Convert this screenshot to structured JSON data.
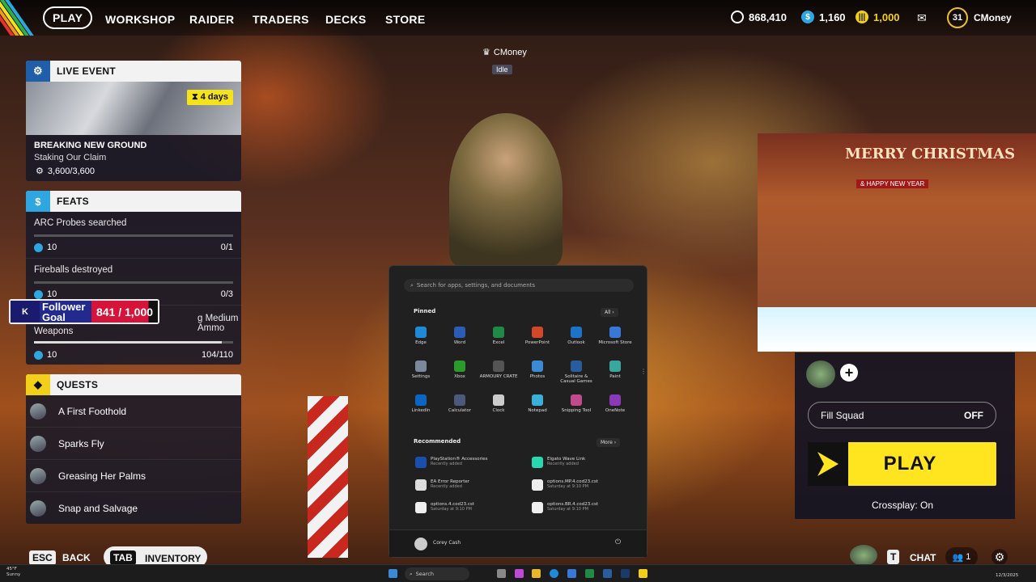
{
  "nav": {
    "play": "PLAY",
    "workshop": "WORKSHOP",
    "raider": "RAIDER",
    "traders": "TRADERS",
    "decks": "DECKS",
    "store": "STORE"
  },
  "currency": {
    "coins": "868,410",
    "tokens": "1,160",
    "credits": "1,000"
  },
  "profile": {
    "level": "31",
    "username": "CMoney"
  },
  "live_event": {
    "header": "LIVE EVENT",
    "days": "4 days",
    "title": "BREAKING NEW GROUND",
    "subtitle": "Staking Our Claim",
    "progress": "3,600/3,600"
  },
  "feats": {
    "header": "FEATS",
    "items": [
      {
        "name": "ARC Probes searched",
        "reward": "10",
        "count": "0/1",
        "progress": 0
      },
      {
        "name": "Fireballs destroyed",
        "reward": "10",
        "count": "0/3",
        "progress": 0
      },
      {
        "name_tail": "g Medium Ammo",
        "name": "Weapons",
        "reward": "10",
        "count": "104/110",
        "progress": 0.945
      }
    ]
  },
  "follower_goal": {
    "label": "Follower Goal",
    "value": "841 / 1,000",
    "fraction": 0.841
  },
  "quests": {
    "header": "QUESTS",
    "items": [
      "A First Foothold",
      "Sparks Fly",
      "Greasing Her Palms",
      "Snap and Salvage"
    ]
  },
  "bottom_left": {
    "esc_key": "ESC",
    "back": "BACK",
    "tab_key": "TAB",
    "inventory": "INVENTORY"
  },
  "center": {
    "name": "CMoney",
    "status": "Idle"
  },
  "overlay": {
    "title": "MERRY CHRISTMAS",
    "subtitle": "& HAPPY NEW YEAR"
  },
  "squad": {
    "fill_label": "Fill Squad",
    "fill_value": "OFF",
    "play": "PLAY",
    "crossplay": "Crossplay: On"
  },
  "bottom_right": {
    "t_key": "T",
    "chat": "CHAT",
    "friends": "1"
  },
  "start_menu": {
    "search_placeholder": "Search for apps, settings, and documents",
    "pinned_label": "Pinned",
    "all_label": "All",
    "pinned": [
      {
        "name": "Edge",
        "color": "#1f8ad8"
      },
      {
        "name": "Word",
        "color": "#2b5cb8"
      },
      {
        "name": "Excel",
        "color": "#1e8a45"
      },
      {
        "name": "PowerPoint",
        "color": "#d2472a"
      },
      {
        "name": "Outlook",
        "color": "#1d72c9"
      },
      {
        "name": "Microsoft Store",
        "color": "#3a78d8"
      },
      {
        "name": "Settings",
        "color": "#7a8a9c"
      },
      {
        "name": "Xbox",
        "color": "#2a9a2a"
      },
      {
        "name": "ARMOURY CRATE",
        "color": "#555555"
      },
      {
        "name": "Photos",
        "color": "#3a8ad6"
      },
      {
        "name": "Solitaire & Casual Games",
        "color": "#2a5ca0"
      },
      {
        "name": "Paint",
        "color": "#3aa6a0"
      },
      {
        "name": "LinkedIn",
        "color": "#0a66c2"
      },
      {
        "name": "Calculator",
        "color": "#4a5a7a"
      },
      {
        "name": "Clock",
        "color": "#cccccc"
      },
      {
        "name": "Notepad",
        "color": "#3ab0d8"
      },
      {
        "name": "Snipping Tool",
        "color": "#c04a8a"
      },
      {
        "name": "OneNote",
        "color": "#8a3ab8"
      }
    ],
    "recommended_label": "Recommended",
    "more_label": "More",
    "recommended": [
      {
        "name": "PlayStation® Accessories",
        "meta": "Recently added",
        "color": "#1a4fb0"
      },
      {
        "name": "Elgato Wave Link",
        "meta": "Recently added",
        "color": "#2ad8b0"
      },
      {
        "name": "EA Error Reporter",
        "meta": "Recently added",
        "color": "#dddddd"
      },
      {
        "name": "options.MP.4.cod23.cst",
        "meta": "Saturday at 9:10 PM",
        "color": "#eeeeee"
      },
      {
        "name": "options.4.cod23.cst",
        "meta": "Saturday at 9:10 PM",
        "color": "#eeeeee"
      },
      {
        "name": "options.BR.4.cod23.cst",
        "meta": "Saturday at 9:10 PM",
        "color": "#eeeeee"
      }
    ],
    "user": "Corey Cash"
  },
  "taskbar": {
    "temp": "45°F",
    "weather": "Sunny",
    "search": "Search",
    "time": "12/3/2025"
  }
}
